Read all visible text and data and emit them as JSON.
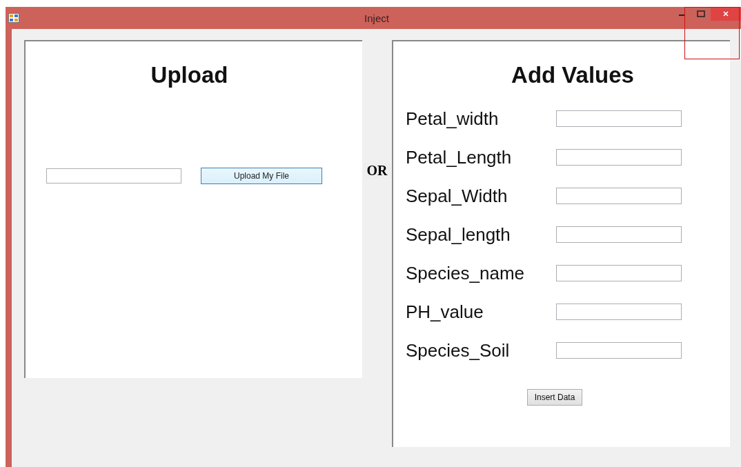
{
  "window": {
    "title": "Inject"
  },
  "upload_panel": {
    "heading": "Upload",
    "upload_button": "Upload My File"
  },
  "separator": "OR",
  "values_panel": {
    "heading": "Add Values",
    "fields": [
      {
        "label": "Petal_width"
      },
      {
        "label": "Petal_Length"
      },
      {
        "label": "Sepal_Width"
      },
      {
        "label": "Sepal_length"
      },
      {
        "label": "Species_name"
      },
      {
        "label": "PH_value"
      },
      {
        "label": "Species_Soil"
      }
    ],
    "submit_button": "Insert Data"
  }
}
